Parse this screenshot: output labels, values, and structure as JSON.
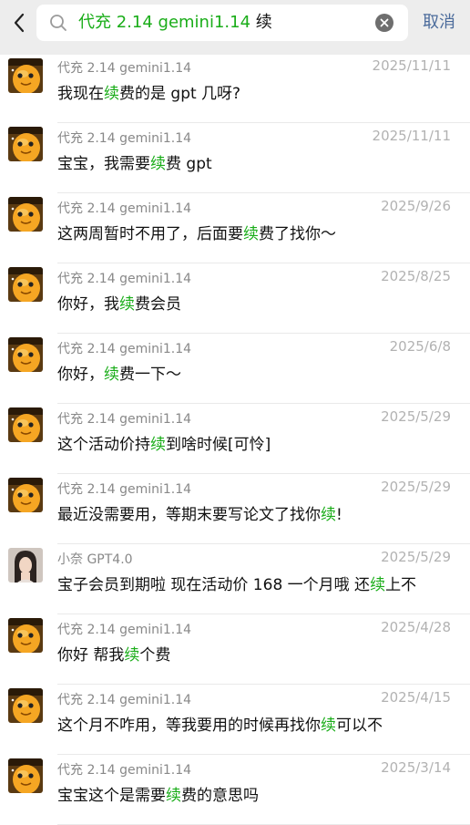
{
  "header": {
    "query_highlight": "代充 2.14 gemini1.14",
    "query_tail": " 续",
    "cancel_label": "取消"
  },
  "keyword": "续",
  "results": [
    {
      "sender": "代充 2.14 gemini1.14",
      "date": "2025/11/11",
      "before": "我现在",
      "keyword": "续",
      "after": "费的是 gpt 几呀?",
      "avatar": "orange-mascot"
    },
    {
      "sender": "代充 2.14 gemini1.14",
      "date": "2025/11/11",
      "before": "宝宝，我需要",
      "keyword": "续",
      "after": "费 gpt",
      "avatar": "orange-mascot"
    },
    {
      "sender": "代充 2.14 gemini1.14",
      "date": "2025/9/26",
      "before": "这两周暂时不用了，后面要",
      "keyword": "续",
      "after": "费了找你～",
      "avatar": "orange-mascot"
    },
    {
      "sender": "代充 2.14 gemini1.14",
      "date": "2025/8/25",
      "before": "你好，我",
      "keyword": "续",
      "after": "费会员",
      "avatar": "orange-mascot"
    },
    {
      "sender": "代充 2.14 gemini1.14",
      "date": "2025/6/8",
      "before": "你好，",
      "keyword": "续",
      "after": "费一下～",
      "avatar": "orange-mascot"
    },
    {
      "sender": "代充 2.14 gemini1.14",
      "date": "2025/5/29",
      "before": "这个活动价持",
      "keyword": "续",
      "after": "到啥时候[可怜]",
      "avatar": "orange-mascot"
    },
    {
      "sender": "代充 2.14 gemini1.14",
      "date": "2025/5/29",
      "before": "最近没需要用，等期末要写论文了找你",
      "keyword": "续",
      "after": "!",
      "avatar": "orange-mascot"
    },
    {
      "sender": "小奈 GPT4.0",
      "date": "2025/5/29",
      "before": "宝子会员到期啦 现在活动价 168 一个月哦 还",
      "keyword": "续",
      "after": "上不",
      "avatar": "person-photo"
    },
    {
      "sender": "代充 2.14 gemini1.14",
      "date": "2025/4/28",
      "before": "你好 帮我",
      "keyword": "续",
      "after": "个费",
      "avatar": "orange-mascot"
    },
    {
      "sender": "代充 2.14 gemini1.14",
      "date": "2025/4/15",
      "before": "这个月不咋用，等我要用的时候再找你",
      "keyword": "续",
      "after": "可以不",
      "avatar": "orange-mascot"
    },
    {
      "sender": "代充 2.14 gemini1.14",
      "date": "2025/3/14",
      "before": "宝宝这个是需要",
      "keyword": "续",
      "after": "费的意思吗",
      "avatar": "orange-mascot"
    }
  ],
  "colors": {
    "accent": "#1aad19",
    "topbar": "#ededed",
    "cancel": "#4b6b9b"
  }
}
